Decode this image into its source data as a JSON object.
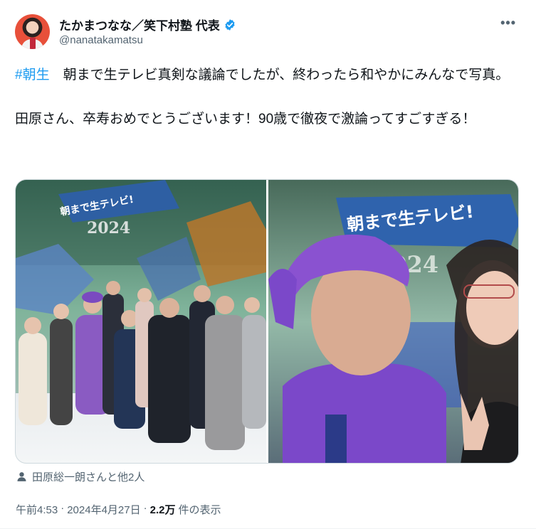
{
  "author": {
    "display_name": "たかまつなな／笑下村塾 代表",
    "handle": "@nanatakamatsu",
    "verified": true
  },
  "colors": {
    "link": "#1d9bf0",
    "verified": "#1d9bf0",
    "muted": "#536471"
  },
  "tweet": {
    "hashtag": "#朝生",
    "text_after_hashtag": "　朝まで生テレビ真剣な議論でしたが、終わったら和やかにみんなで写真。\n\n田原さん、卒寿おめでとうございます！90歳で徹夜で激論ってすごすぎる！"
  },
  "media": {
    "photo1": {
      "sign_text": "朝まで生テレビ!",
      "year_text": "2024"
    },
    "photo2": {
      "sign_text": "朝まで生テレビ!",
      "year_text": "2024"
    }
  },
  "tagged": {
    "icon": "person-icon",
    "label": "田原総一朗さんと他2人"
  },
  "meta": {
    "time": "午前4:53",
    "sep1": "·",
    "date": "2024年4月27日",
    "sep2": "·",
    "views_count": "2.2万",
    "views_label": "件の表示"
  },
  "more_icon": "more-options-icon"
}
